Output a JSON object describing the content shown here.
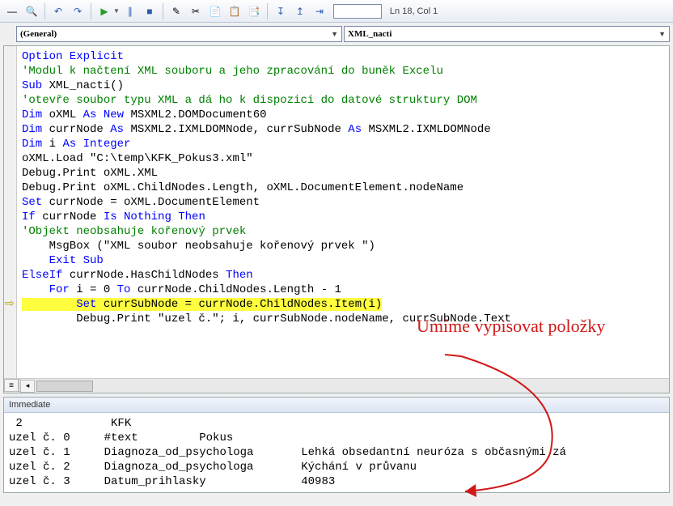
{
  "toolbar": {
    "status": "Ln 18, Col 1"
  },
  "dropdowns": {
    "left": "(General)",
    "right": "XML_nacti"
  },
  "code": {
    "lines": [
      {
        "t": "kw",
        "txt": "Option Explicit"
      },
      {
        "t": "cm",
        "txt": "'Modul k načtení XML souboru a jeho zpracování do buněk Excelu"
      },
      {
        "t": "mix",
        "parts": [
          [
            "kw",
            "Sub"
          ],
          [
            "",
            " XML_nacti()"
          ]
        ]
      },
      {
        "t": "cm",
        "txt": "'otevře soubor typu XML a dá ho k dispozici do datové struktury DOM"
      },
      {
        "t": "mix",
        "parts": [
          [
            "kw",
            "Dim"
          ],
          [
            "",
            " oXML "
          ],
          [
            "kw",
            "As New"
          ],
          [
            "",
            " MSXML2.DOMDocument60"
          ]
        ]
      },
      {
        "t": "mix",
        "parts": [
          [
            "kw",
            "Dim"
          ],
          [
            "",
            " currNode "
          ],
          [
            "kw",
            "As"
          ],
          [
            "",
            " MSXML2.IXMLDOMNode, currSubNode "
          ],
          [
            "kw",
            "As"
          ],
          [
            "",
            " MSXML2.IXMLDOMNode"
          ]
        ]
      },
      {
        "t": "mix",
        "parts": [
          [
            "kw",
            "Dim"
          ],
          [
            "",
            " i "
          ],
          [
            "kw",
            "As Integer"
          ]
        ]
      },
      {
        "t": "",
        "txt": "oXML.Load \"C:\\temp\\KFK_Pokus3.xml\""
      },
      {
        "t": "",
        "txt": "Debug.Print oXML.XML"
      },
      {
        "t": "",
        "txt": "Debug.Print oXML.ChildNodes.Length, oXML.DocumentElement.nodeName"
      },
      {
        "t": "mix",
        "parts": [
          [
            "kw",
            "Set"
          ],
          [
            "",
            " currNode = oXML.DocumentElement"
          ]
        ]
      },
      {
        "t": "mix",
        "parts": [
          [
            "kw",
            "If"
          ],
          [
            "",
            " currNode "
          ],
          [
            "kw",
            "Is Nothing Then"
          ]
        ]
      },
      {
        "t": "cm",
        "txt": "'Objekt neobsahuje kořenový prvek"
      },
      {
        "t": "",
        "txt": "    MsgBox (\"XML soubor neobsahuje kořenový prvek \")"
      },
      {
        "t": "mix",
        "parts": [
          [
            "",
            "    "
          ],
          [
            "kw",
            "Exit Sub"
          ]
        ]
      },
      {
        "t": "mix",
        "parts": [
          [
            "kw",
            "ElseIf"
          ],
          [
            "",
            " currNode.HasChildNodes "
          ],
          [
            "kw",
            "Then"
          ]
        ]
      },
      {
        "t": "mix",
        "parts": [
          [
            "",
            "    "
          ],
          [
            "kw",
            "For"
          ],
          [
            "",
            " i = 0 "
          ],
          [
            "kw",
            "To"
          ],
          [
            "",
            " currNode.ChildNodes.Length - 1"
          ]
        ]
      },
      {
        "t": "hl",
        "parts": [
          [
            "",
            "        "
          ],
          [
            "kw",
            "Set"
          ],
          [
            "",
            " currSubNode = currNode.ChildNodes.Item(i)"
          ]
        ]
      },
      {
        "t": "",
        "txt": "        Debug.Print \"uzel č.\"; i, currSubNode.nodeName, currSubNode.Text"
      }
    ],
    "break_line_index": 17
  },
  "immediate": {
    "title": "Immediate",
    "rows": [
      " 2             KFK",
      "uzel č. 0     #text         Pokus",
      "uzel č. 1     Diagnoza_od_psychologa       Lehká obsedantní neuróza s občasnými zá",
      "uzel č. 2     Diagnoza_od_psychologa       Kýchání v průvanu",
      "uzel č. 3     Datum_prihlasky              40983"
    ]
  },
  "annotation": {
    "text": "Umíme vypisovat položky"
  },
  "icons": {
    "dash": "—",
    "find": "🔍",
    "undo": "↶",
    "redo": "↷",
    "play": "▶",
    "pause": "∥",
    "stop": "■",
    "edit1": "✎",
    "edit2": "✂",
    "edit3": "📄",
    "edit4": "📋",
    "edit5": "📑",
    "step1": "↧",
    "step2": "↥",
    "step3": "⇥"
  }
}
